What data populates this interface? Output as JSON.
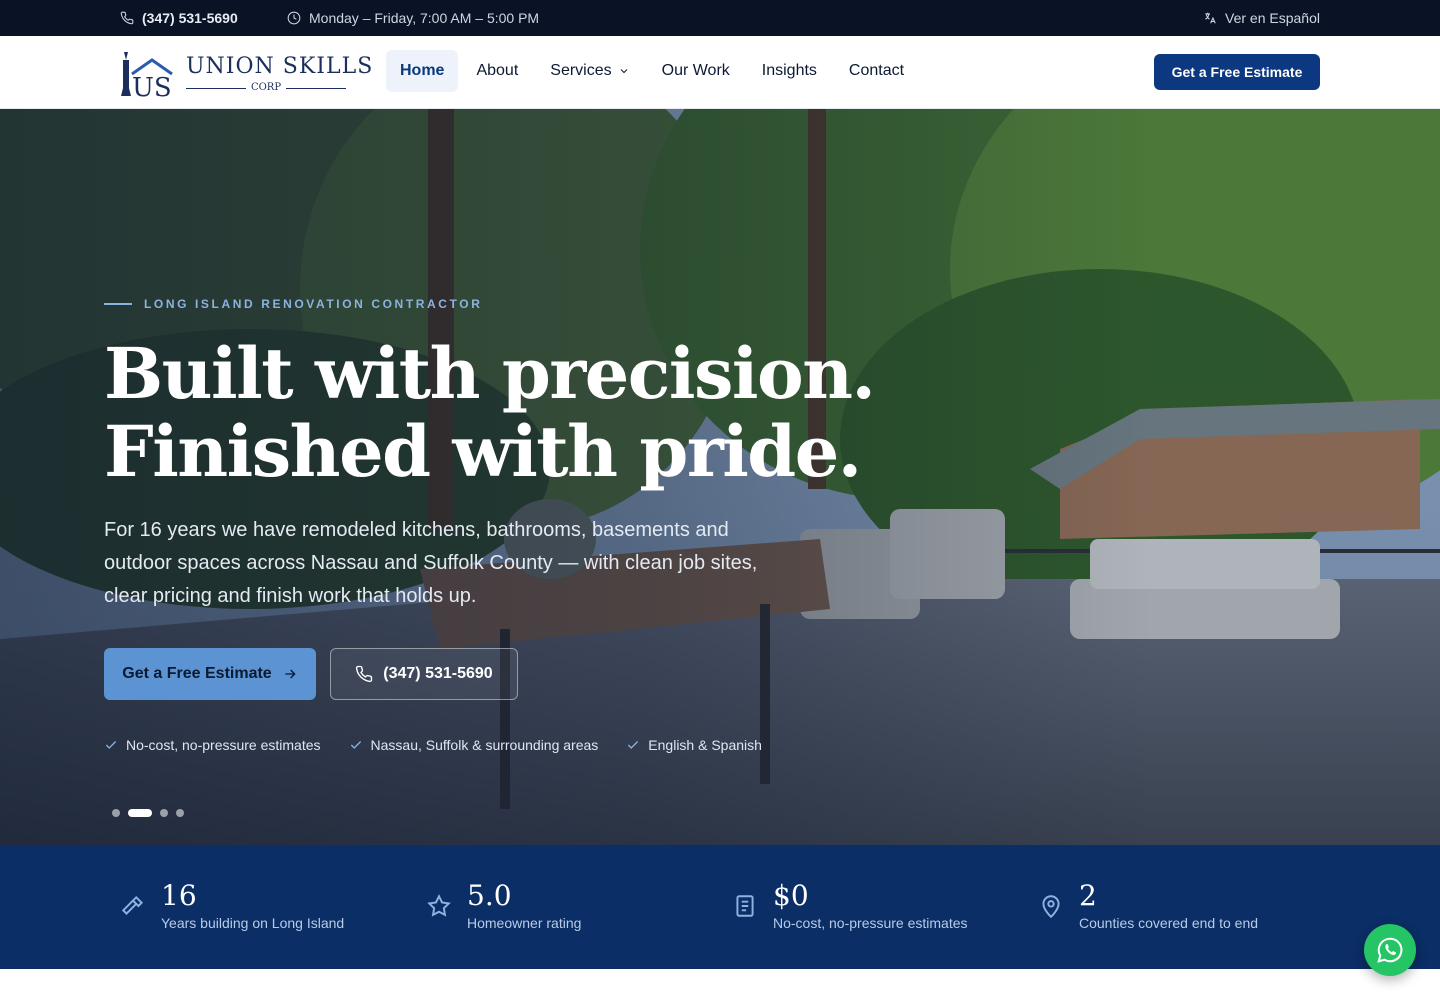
{
  "topbar": {
    "phone": "(347) 531-5690",
    "hours": "Monday – Friday, 7:00 AM – 5:00 PM",
    "language_link": "Ver en Español"
  },
  "brand": {
    "name_part1": "UNION",
    "name_part2": "SKILLS",
    "suffix": "CORP",
    "monogram": "US"
  },
  "nav": {
    "items": [
      {
        "label": "Home",
        "active": true
      },
      {
        "label": "About"
      },
      {
        "label": "Services",
        "dropdown": true
      },
      {
        "label": "Our Work"
      },
      {
        "label": "Insights"
      },
      {
        "label": "Contact"
      }
    ],
    "cta": "Get a Free Estimate"
  },
  "hero": {
    "eyebrow": "LONG ISLAND RENOVATION CONTRACTOR",
    "headline_line1": "Built with precision.",
    "headline_line2": "Finished with pride.",
    "subcopy": "For 16 years we have remodeled kitchens, bathrooms, basements and outdoor spaces across Nassau and Suffolk County — with clean job sites, clear pricing and finish work that holds up.",
    "primary_cta": "Get a Free Estimate",
    "secondary_cta": "(347) 531-5690",
    "checks": [
      "No-cost, no-pressure estimates",
      "Nassau, Suffolk & surrounding areas",
      "English & Spanish"
    ],
    "slides_total": 4,
    "active_slide": 2
  },
  "stats": [
    {
      "icon": "hammer-icon",
      "value": "16",
      "label": "Years building on Long Island"
    },
    {
      "icon": "star-icon",
      "value": "5.0",
      "label": "Homeowner rating"
    },
    {
      "icon": "clipboard-icon",
      "value": "$0",
      "label": "No-cost, no-pressure estimates"
    },
    {
      "icon": "map-pin-icon",
      "value": "2",
      "label": "Counties covered end to end"
    }
  ],
  "colors": {
    "topbar_bg": "#0a1226",
    "brand_navy": "#0b3880",
    "stats_bg": "#0b2e66",
    "accent_blue": "#5b93d3",
    "whatsapp_green": "#25c464"
  }
}
